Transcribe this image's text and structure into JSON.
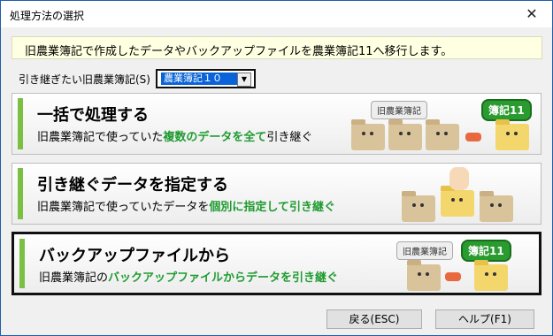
{
  "window": {
    "title": "処理方法の選択"
  },
  "info": {
    "text": "旧農業簿記で作成したデータやバックアップファイルを農業簿記11へ移行します。"
  },
  "select": {
    "label": "引き継ぎたい旧農業簿記(S)",
    "value": "農業簿記１０"
  },
  "options": [
    {
      "title": "一括で処理する",
      "desc_pre": "旧農業簿記で使っていた",
      "desc_em": "複数のデータを全て",
      "desc_post": "引き継ぐ"
    },
    {
      "title": "引き継ぐデータを指定する",
      "desc_pre": "旧農業簿記で使っていたデータを",
      "desc_em": "個別に指定して引き継ぐ",
      "desc_post": ""
    },
    {
      "title": "バックアップファイルから",
      "desc_pre": "旧農業簿記の",
      "desc_em": "バックアップファイルからデータを引き継ぐ",
      "desc_post": ""
    }
  ],
  "illustration": {
    "old_label": "旧農業簿記",
    "new_label": "簿記11"
  },
  "buttons": {
    "back": "戻る(ESC)",
    "help": "ヘルプ(F1)"
  },
  "colors": {
    "accent": "#7bc043",
    "highlight": "#1f9b31",
    "info_bg": "#ffffe1"
  },
  "icons": {
    "close": "close-icon",
    "dropdown": "chevron-down-icon"
  }
}
